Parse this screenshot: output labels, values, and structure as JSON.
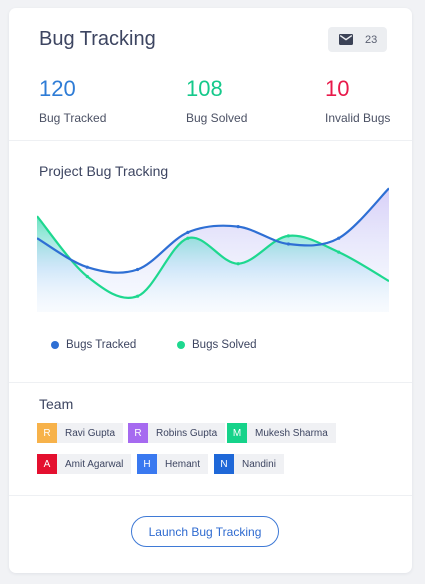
{
  "header": {
    "title": "Bug Tracking",
    "mail_icon": "mail-icon",
    "mail_count": "23"
  },
  "stats": [
    {
      "value": "120",
      "label": "Bug Tracked",
      "color": "#2e7cd6"
    },
    {
      "value": "108",
      "label": "Bug Solved",
      "color": "#15c98b"
    },
    {
      "value": "10",
      "label": "Invalid Bugs",
      "color": "#e8194a"
    }
  ],
  "chart_title": "Project Bug Tracking",
  "chart_data": {
    "type": "area",
    "x": [
      0,
      1,
      2,
      3,
      4,
      5,
      6,
      7
    ],
    "ylim": [
      0,
      100
    ],
    "grid": false,
    "legend_position": "bottom",
    "series": [
      {
        "name": "Bugs Tracked",
        "color": "#2e6fd4",
        "values": [
          55,
          30,
          28,
          60,
          65,
          50,
          55,
          98
        ]
      },
      {
        "name": "Bugs Solved",
        "color": "#1ed88f",
        "values": [
          74,
          22,
          5,
          55,
          33,
          57,
          43,
          18
        ]
      }
    ]
  },
  "team": {
    "title": "Team",
    "members": [
      {
        "initial": "R",
        "name": "Ravi Gupta",
        "color": "#f7b24a"
      },
      {
        "initial": "R",
        "name": "Robins Gupta",
        "color": "#a66af0"
      },
      {
        "initial": "M",
        "name": "Mukesh Sharma",
        "color": "#16d38a"
      },
      {
        "initial": "A",
        "name": "Amit Agarwal",
        "color": "#e4102f"
      },
      {
        "initial": "H",
        "name": "Hemant",
        "color": "#3a79f0"
      },
      {
        "initial": "N",
        "name": "Nandini",
        "color": "#1f68d8"
      }
    ]
  },
  "launch_label": "Launch Bug Tracking"
}
